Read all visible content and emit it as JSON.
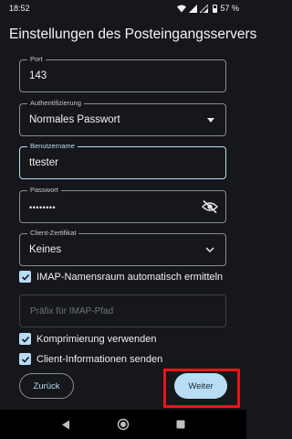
{
  "status_bar": {
    "time": "18:52",
    "battery": "57 %"
  },
  "title": "Einstellungen des Posteingangsservers",
  "fields": {
    "port": {
      "label": "Port",
      "value": "143"
    },
    "auth": {
      "label": "Authentifizierung",
      "value": "Normales Passwort"
    },
    "username": {
      "label": "Benutzername",
      "value": "ttester"
    },
    "password": {
      "label": "Passwort",
      "value": "••••••••"
    },
    "certificate": {
      "label": "Client-Zertifikat",
      "value": "Keines"
    },
    "prefix": {
      "placeholder": "Präfix für IMAP-Pfad"
    }
  },
  "checkboxes": {
    "namespace": {
      "label": "IMAP-Namensraum automatisch ermitteln",
      "checked": true
    },
    "compression": {
      "label": "Komprimierung verwenden",
      "checked": true
    },
    "client_info": {
      "label": "Client-Informationen senden",
      "checked": true
    }
  },
  "buttons": {
    "back": "Zurück",
    "next": "Weiter"
  },
  "colors": {
    "accent": "#b9dcf5",
    "highlight": "#e8141a",
    "background": "#15171a"
  }
}
